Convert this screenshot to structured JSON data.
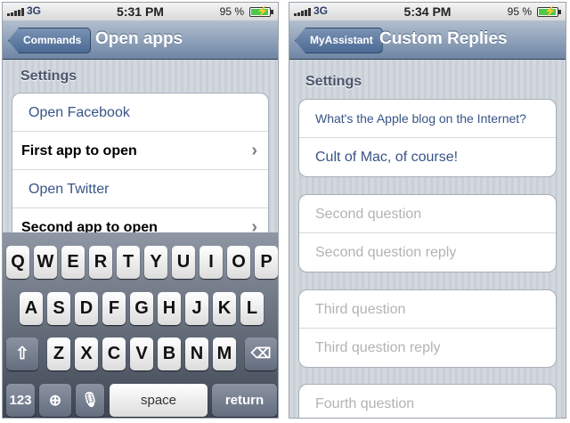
{
  "left": {
    "status": {
      "carrier": "3G",
      "time": "5:31 PM",
      "battery": "95 %"
    },
    "nav": {
      "back": "Commands",
      "title": "Open apps"
    },
    "section": "Settings",
    "rows": [
      {
        "text": "Open Facebook"
      },
      {
        "text": "First app to open"
      },
      {
        "text": "Open Twitter"
      },
      {
        "text": "Second app to open"
      }
    ]
  },
  "keyboard": {
    "row1": [
      "Q",
      "W",
      "E",
      "R",
      "T",
      "Y",
      "U",
      "I",
      "O",
      "P"
    ],
    "row2": [
      "A",
      "S",
      "D",
      "F",
      "G",
      "H",
      "J",
      "K",
      "L"
    ],
    "row3": [
      "Z",
      "X",
      "C",
      "V",
      "B",
      "N",
      "M"
    ],
    "numbers": "123",
    "space": "space",
    "return": "return"
  },
  "right": {
    "status": {
      "carrier": "3G",
      "time": "5:34 PM",
      "battery": "95 %"
    },
    "nav": {
      "back": "MyAssistant",
      "title": "Custom Replies"
    },
    "section": "Settings",
    "group1": {
      "question": "What's the Apple blog on the Internet?",
      "reply": "Cult of Mac, of course!"
    },
    "group2": {
      "question": "Second question",
      "reply": "Second question reply"
    },
    "group3": {
      "question": "Third question",
      "reply": "Third question reply"
    },
    "group4": {
      "question": "Fourth question"
    }
  },
  "colors": {
    "navbar": "#6f86a5",
    "value_text": "#385487",
    "placeholder": "#b3b3b3",
    "battery": "#4cc94a"
  }
}
